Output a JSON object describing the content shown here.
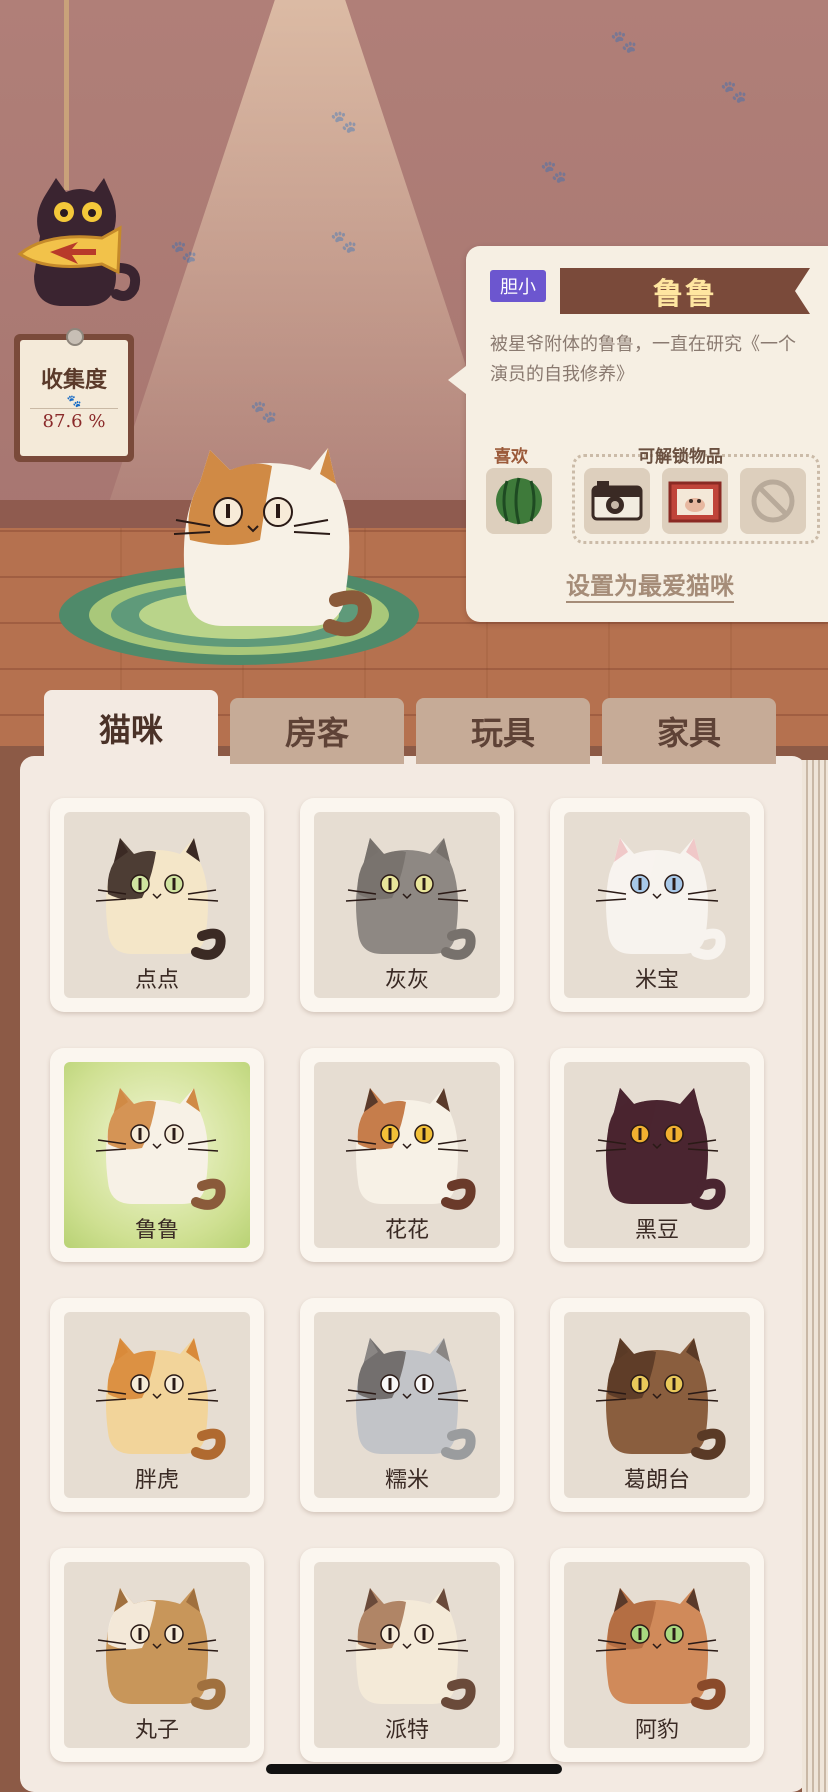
{
  "profile": {
    "trait_badge": "胆小",
    "name": "鲁鲁",
    "description": "被星爷附体的鲁鲁，一直在研究《一个演员的自我修养》",
    "likes_label": "喜欢",
    "unlockables_label": "可解锁物品",
    "liked_item_icon": "watermelon-icon",
    "unlockable_icons": [
      "camera-icon",
      "cat-picture-icon",
      "locked-icon"
    ],
    "set_favorite_label": "设置为最爱猫咪"
  },
  "collection": {
    "title": "收集度",
    "value": "87.6 %",
    "paw_glyph": "🐾"
  },
  "tabs": [
    {
      "label": "猫咪",
      "active": true
    },
    {
      "label": "房客",
      "active": false
    },
    {
      "label": "玩具",
      "active": false
    },
    {
      "label": "家具",
      "active": false
    }
  ],
  "cats": [
    {
      "name": "点点",
      "body": "#f4e6c8",
      "patch": "#3b2a24",
      "ear": "#3b2a24",
      "eye": "#cfe3a0",
      "tail": "#3b2a24",
      "selected": false
    },
    {
      "name": "灰灰",
      "body": "#8e8883",
      "patch": "#77716c",
      "ear": "#77716c",
      "eye": "#e8e59a",
      "tail": "#77716c",
      "selected": false
    },
    {
      "name": "米宝",
      "body": "#f7f3ee",
      "patch": "#f7f3ee",
      "ear": "#f0c8c8",
      "eye": "#a8c8e8",
      "tail": "#f7f3ee",
      "selected": false
    },
    {
      "name": "鲁鲁",
      "body": "#f7f1e6",
      "patch": "#d08a45",
      "ear": "#d08a45",
      "eye": "#f5ebd8",
      "tail": "#8a5a3a",
      "selected": true
    },
    {
      "name": "花花",
      "body": "#f7f1e6",
      "patch": "#c0703a",
      "ear": "#5a3a2a",
      "eye": "#f2c038",
      "tail": "#6a3a2a",
      "selected": false
    },
    {
      "name": "黑豆",
      "body": "#4a2530",
      "patch": "#4a2530",
      "ear": "#4a2530",
      "eye": "#f0b030",
      "tail": "#4a2530",
      "selected": false
    },
    {
      "name": "胖虎",
      "body": "#f2d49a",
      "patch": "#d98a3a",
      "ear": "#d98a3a",
      "eye": "#f7ecd8",
      "tail": "#b06a30",
      "selected": false
    },
    {
      "name": "糯米",
      "body": "#c2c4c8",
      "patch": "#6a6664",
      "ear": "#8a8684",
      "eye": "#f7f7f7",
      "tail": "#9a9c9e",
      "selected": false
    },
    {
      "name": "葛朗台",
      "body": "#8a5e3e",
      "patch": "#5a3a26",
      "ear": "#5a3a26",
      "eye": "#e8c85a",
      "tail": "#5a3a26",
      "selected": false
    },
    {
      "name": "丸子",
      "body": "#c8965a",
      "patch": "#f7f1e6",
      "ear": "#a0703e",
      "eye": "#f7ecd8",
      "tail": "#a0703e",
      "selected": false
    },
    {
      "name": "派特",
      "body": "#f4ead8",
      "patch": "#a87a5a",
      "ear": "#6a4a3a",
      "eye": "#f7ecd8",
      "tail": "#6a4a3a",
      "selected": false
    },
    {
      "name": "阿豹",
      "body": "#d08a5a",
      "patch": "#b06a40",
      "ear": "#5a3a2a",
      "eye": "#a8d880",
      "tail": "#8a4a2a",
      "selected": false
    }
  ],
  "main_cat": {
    "body": "#f7f1e6",
    "patch": "#d08a45",
    "tail": "#8a5a3a"
  },
  "colors": {
    "trait_badge": "#6c56cf",
    "name_ribbon": "#7a4a3a",
    "selected_cell": "#cfe092"
  },
  "icons": {
    "back": "back-arrow-icon",
    "paw": "paw-icon"
  }
}
